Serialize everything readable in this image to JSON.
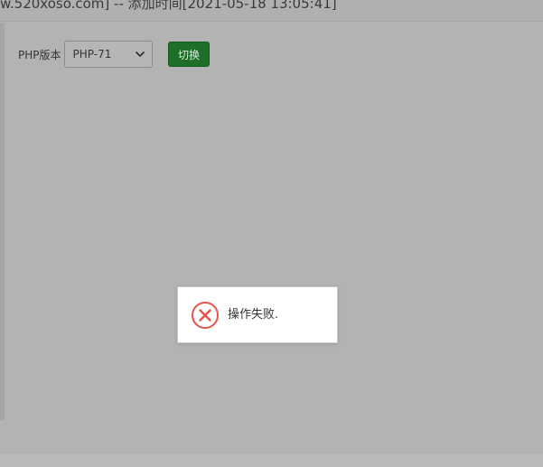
{
  "header": {
    "title": "w.520xoso.com] -- 添加时间[2021-05-18 13:05:41]"
  },
  "php": {
    "label": "PHP版本",
    "selected": "PHP-71",
    "switch_label": "切换"
  },
  "toast": {
    "message": "操作失败.",
    "icon": "error-icon"
  },
  "colors": {
    "button_green": "#1e6e28",
    "error_red": "#e8534a",
    "overlay_gray": "#b3b3b3"
  }
}
